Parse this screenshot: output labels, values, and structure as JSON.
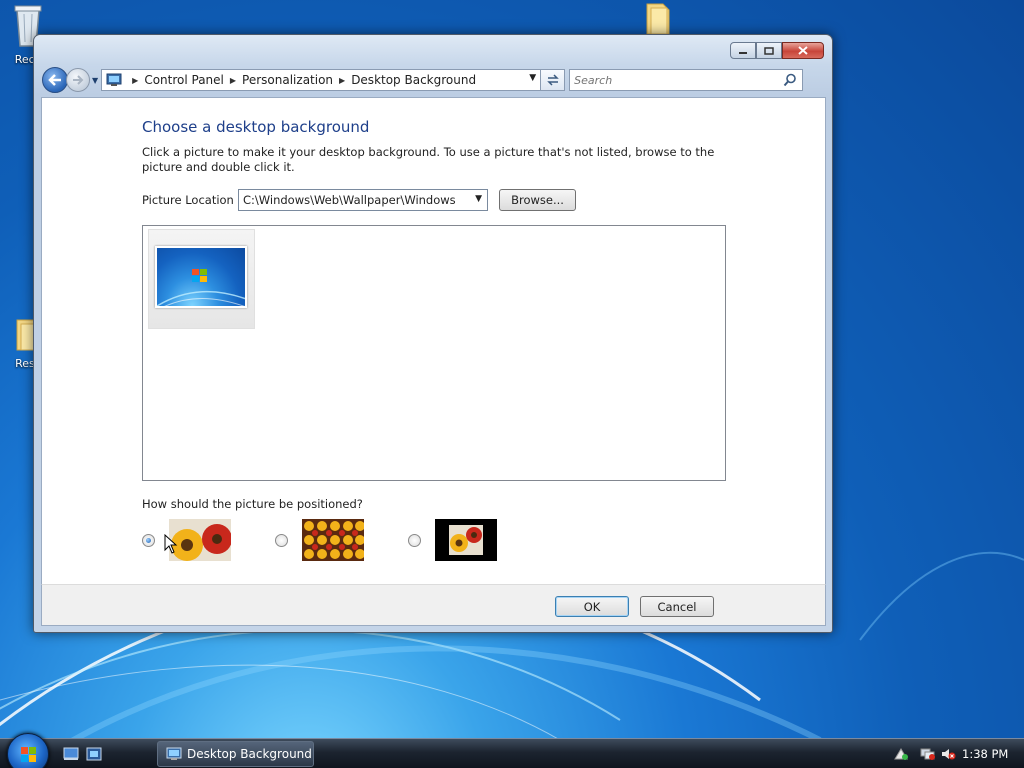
{
  "desktop": {
    "icons": [
      {
        "label": "Recy"
      },
      {
        "label": "Resc"
      }
    ]
  },
  "window": {
    "breadcrumb": [
      "Control Panel",
      "Personalization",
      "Desktop Background"
    ],
    "search_placeholder": "Search",
    "title": "Choose a desktop background",
    "description": "Click a picture to make it your desktop background. To use a picture that's not listed, browse to the picture and double click it.",
    "location_label": "Picture Location",
    "location_value": "C:\\Windows\\Web\\Wallpaper\\Windows",
    "browse_label": "Browse...",
    "position_label": "How should the picture be positioned?",
    "position_options": [
      {
        "name": "fit-to-screen",
        "selected": true
      },
      {
        "name": "tile",
        "selected": false
      },
      {
        "name": "center",
        "selected": false
      }
    ],
    "ok_label": "OK",
    "cancel_label": "Cancel"
  },
  "taskbar": {
    "active_task": "Desktop Background",
    "clock": "1:38 PM"
  },
  "colors": {
    "title_blue": "#1e3f8a",
    "desktop_blue": "#1a78d4"
  }
}
